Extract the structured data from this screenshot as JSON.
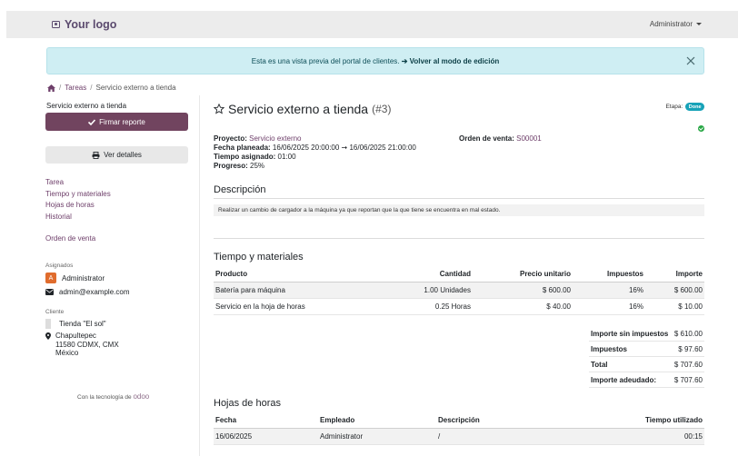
{
  "header": {
    "logo_text": "Your logo",
    "user_name": "Administrator"
  },
  "alert": {
    "text": "Esta es una vista previa del portal de clientes. ",
    "link": "➔ Volver al modo de edición"
  },
  "breadcrumb": {
    "home_icon": "home-icon",
    "items": [
      "Tareas",
      "Servicio externo a tienda"
    ]
  },
  "sidebar": {
    "task_name": "Servicio externo a tienda",
    "sign_button": "Firmar reporte",
    "details_button": "Ver detalles",
    "nav": [
      "Tarea",
      "Tiempo y materiales",
      "Hojas de horas",
      "Historial"
    ],
    "order_link": "Orden de venta",
    "assigned_label": "Asignados",
    "assignee": "Administrator",
    "assignee_initial": "A",
    "email": "admin@example.com",
    "client_label": "Cliente",
    "client_name": "Tienda \"El sol\"",
    "address_lines": [
      "Chapultepec",
      "11580 CDMX, CMX",
      "México"
    ],
    "powered_text": "Con la tecnología de ",
    "powered_brand": "odoo"
  },
  "task": {
    "title": "Servicio externo a tienda",
    "number": "(#3)",
    "stage_label": "Etapa:",
    "stage_value": "Done",
    "project_label": "Proyecto:",
    "project_value": "Servicio externo",
    "planned_label": "Fecha planeada:",
    "planned_value": "16/06/2025 20:00:00 ➞ 16/06/2025 21:00:00",
    "assigned_time_label": "Tiempo asignado:",
    "assigned_time_value": "01:00",
    "progress_label": "Progreso:",
    "progress_value": "25%",
    "order_label": "Orden de venta:",
    "order_value": "S00001"
  },
  "description": {
    "title": "Descripción",
    "text": "Realizar un cambio de cargador a la máquina ya que reportan que la que tiene se encuentra en mal estado."
  },
  "materials": {
    "title": "Tiempo y materiales",
    "columns": [
      "Producto",
      "Cantidad",
      "Precio unitario",
      "Impuestos",
      "Importe"
    ],
    "rows": [
      [
        "Batería para máquina",
        "1.00 Unidades",
        "$ 600.00",
        "16%",
        "$ 600.00"
      ],
      [
        "Servicio en la hoja de horas",
        "0.25 Horas",
        "$ 40.00",
        "16%",
        "$ 10.00"
      ]
    ],
    "totals": [
      {
        "label": "Importe sin impuestos",
        "value": "$ 610.00"
      },
      {
        "label": "Impuestos",
        "value": "$ 97.60"
      },
      {
        "label": "Total",
        "value": "$ 707.60"
      },
      {
        "label": "Importe adeudado:",
        "value": "$ 707.60"
      }
    ]
  },
  "timesheets": {
    "title": "Hojas de horas",
    "columns": [
      "Fecha",
      "Empleado",
      "Descripción",
      "Tiempo utilizado"
    ],
    "rows": [
      [
        "16/06/2025",
        "Administrator",
        "/",
        "00:15"
      ]
    ]
  },
  "colors": {
    "brand": "#71445f",
    "link": "#6e3f6a",
    "alert_bg": "#cfeef3",
    "badge": "#17a2b8",
    "success": "#28a745"
  }
}
